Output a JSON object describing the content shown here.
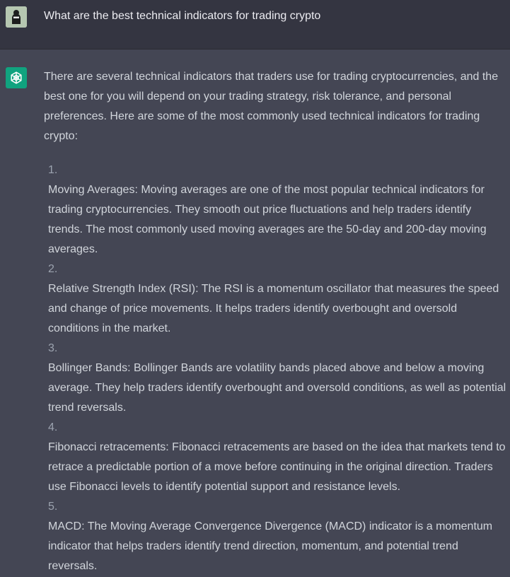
{
  "conversation": {
    "user_question": "What are the best technical indicators for trading crypto",
    "assistant_intro": "There are several technical indicators that traders use for trading cryptocurrencies, and the best one for you will depend on your trading strategy, risk tolerance, and personal preferences. Here are some of the most commonly used technical indicators for trading crypto:",
    "items": [
      {
        "number": "1.",
        "text": "Moving Averages: Moving averages are one of the most popular technical indicators for trading cryptocurrencies. They smooth out price fluctuations and help traders identify trends. The most commonly used moving averages are the 50-day and 200-day moving averages."
      },
      {
        "number": "2.",
        "text": "Relative Strength Index (RSI): The RSI is a momentum oscillator that measures the speed and change of price movements. It helps traders identify overbought and oversold conditions in the market."
      },
      {
        "number": "3.",
        "text": "Bollinger Bands: Bollinger Bands are volatility bands placed above and below a moving average. They help traders identify overbought and oversold conditions, as well as potential trend reversals."
      },
      {
        "number": "4.",
        "text": "Fibonacci retracements: Fibonacci retracements are based on the idea that markets tend to retrace a predictable portion of a move before continuing in the original direction. Traders use Fibonacci levels to identify potential support and resistance levels."
      },
      {
        "number": "5.",
        "text": "MACD: The Moving Average Convergence Divergence (MACD) indicator is a momentum indicator that helps traders identify trend direction, momentum, and potential trend reversals."
      }
    ]
  },
  "icons": {
    "user_avatar": "user-avatar-icon",
    "assistant_avatar": "openai-logo-icon"
  },
  "colors": {
    "user_row_bg": "#343541",
    "assistant_row_bg": "#444654",
    "assistant_avatar_bg": "#10a37f",
    "text": "#d1d5db",
    "list_number": "#9ca3af"
  }
}
